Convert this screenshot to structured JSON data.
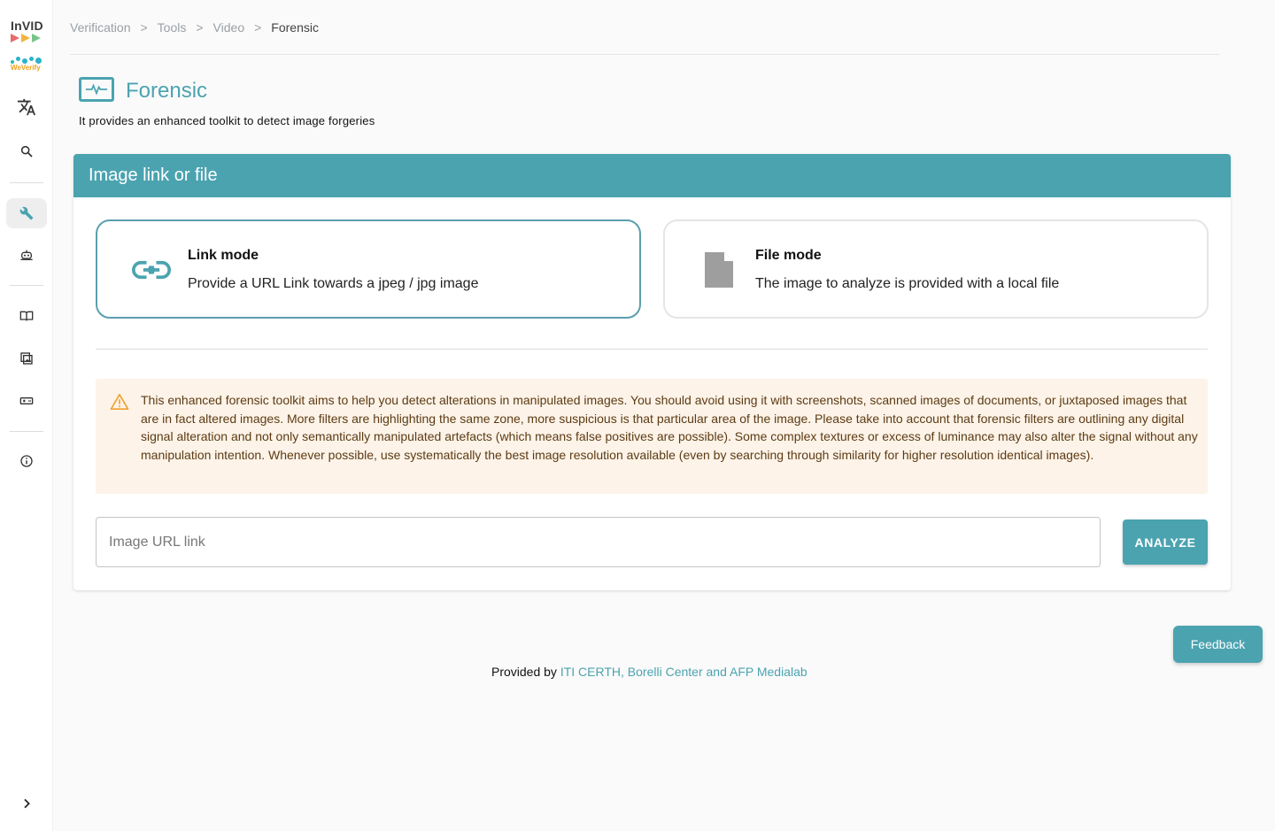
{
  "sidebar": {
    "logo_invid": "InVID",
    "logo_weverify": "WeVerify",
    "items": [
      {
        "name": "translate-icon",
        "active": false
      },
      {
        "name": "search-icon",
        "active": false
      },
      {
        "name": "wrench-icon",
        "active": true
      },
      {
        "name": "assistant-robot-icon",
        "active": false
      },
      {
        "name": "book-icon",
        "active": false
      },
      {
        "name": "image-gallery-icon",
        "active": false
      },
      {
        "name": "game-ticket-icon",
        "active": false
      },
      {
        "name": "info-icon",
        "active": false
      },
      {
        "name": "chevron-right-icon",
        "active": false
      }
    ]
  },
  "breadcrumb": {
    "items": [
      "Verification",
      "Tools",
      "Video"
    ],
    "separator": ">",
    "current": "Forensic"
  },
  "header": {
    "title": "Forensic",
    "subtitle": "It provides an enhanced toolkit to detect image forgeries"
  },
  "card": {
    "title": "Image link or file",
    "link_mode": {
      "title": "Link mode",
      "description": "Provide a URL Link towards a jpeg / jpg image",
      "selected": true
    },
    "file_mode": {
      "title": "File mode",
      "description": "The image to analyze is provided with a local file",
      "selected": false
    },
    "warning": "This enhanced forensic toolkit aims to help you detect alterations in manipulated images. You should avoid using it with screenshots, scanned images of documents, or juxtaposed images that are in fact altered images. More filters are highlighting the same zone, more suspicious is that particular area of the image. Please take into account that forensic filters are outlining any digital signal alteration and not only semantically manipulated artefacts (which means false positives are possible). Some complex textures or excess of luminance may also alter the signal without any manipulation intention. Whenever possible, use systematically the best image resolution available (even by searching through similarity for higher resolution identical images).",
    "url_input": {
      "placeholder": "Image URL link",
      "value": ""
    },
    "analyze_label": "ANALYZE"
  },
  "feedback_label": "Feedback",
  "footer": {
    "prefix": "Provided by",
    "link": "ITI CERTH, Borelli Center and AFP Medialab"
  },
  "colors": {
    "accent": "#4ba3b0",
    "warning_bg": "#fdf3e8",
    "warning_text": "#5c3b14",
    "warning_icon": "#f0a030"
  }
}
